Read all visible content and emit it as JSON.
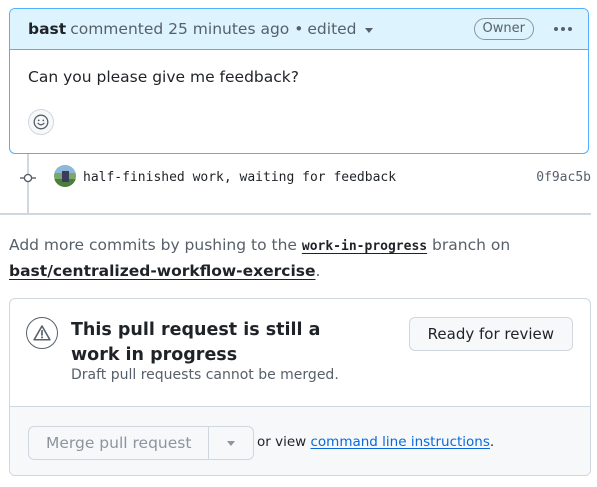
{
  "comment": {
    "author": "bast",
    "action": "commented",
    "time_ago": "25 minutes ago",
    "separator": "•",
    "edited_label": "edited",
    "role_badge": "Owner",
    "body": "Can you please give me feedback?"
  },
  "commit": {
    "message": "half-finished work, waiting for feedback",
    "sha": "0f9ac5b"
  },
  "info": {
    "prefix": "Add more commits by pushing to the",
    "branch": "work-in-progress",
    "middle": "branch on",
    "repo": "bast/centralized-workflow-exercise",
    "suffix": "."
  },
  "merge_box": {
    "title": "This pull request is still a work in progress",
    "subtitle": "Draft pull requests cannot be merged.",
    "ready_button": "Ready for review",
    "merge_button": "Merge pull request",
    "or_view": "or view",
    "cli_link": "command line instructions",
    "period": "."
  },
  "icons": {
    "menu": "kebab-horizontal-icon",
    "emoji": "smiley-icon",
    "commit": "git-commit-icon",
    "alert": "alert-icon",
    "dropdown": "triangle-down-icon"
  },
  "colors": {
    "header_bg": "#ddf4ff",
    "header_border": "#54aeff",
    "link": "#0969da"
  }
}
